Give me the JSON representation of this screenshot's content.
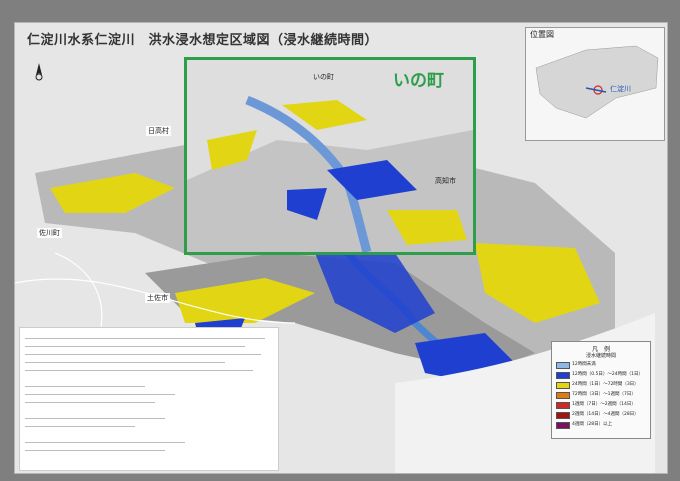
{
  "title": "仁淀川水系仁淀川　洪水浸水想定区域図（浸水継続時間）",
  "inset_map": {
    "title": "位置図",
    "river_label": "仁淀川"
  },
  "zoom_box": {
    "label": "いの町",
    "towns": {
      "ino": "いの町",
      "kochi": "高知市"
    }
  },
  "town_labels": {
    "hidaka": "日高村",
    "sakawa": "佐川町",
    "tosa": "土佐市"
  },
  "legend": {
    "title": "凡　例",
    "subtitle": "浸水継続時間",
    "rows": [
      {
        "label": "12時間未満",
        "color": "#8fb8e8"
      },
      {
        "label": "12時間（0.5日）～24時間（1日）",
        "color": "#1f3fd0"
      },
      {
        "label": "24時間（1日）～72時間（3日）",
        "color": "#e2d514"
      },
      {
        "label": "72時間（3日）～1週間（7日）",
        "color": "#e07a14"
      },
      {
        "label": "1週間（7日）～2週間（14日）",
        "color": "#d02828"
      },
      {
        "label": "2週間（14日）～4週間（28日）",
        "color": "#a01414"
      },
      {
        "label": "4週間（28日）以上",
        "color": "#7a1060"
      }
    ]
  },
  "colors": {
    "frame": "#2e9e4a",
    "flood_blue": "#1f3fd0",
    "flood_yellow": "#e2d514",
    "river": "#8fb8e8"
  }
}
